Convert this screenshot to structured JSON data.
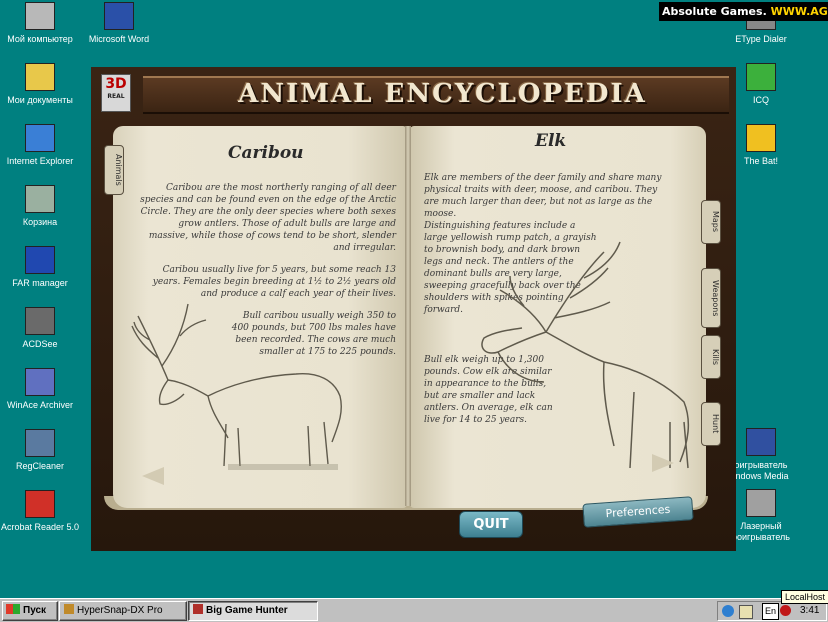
{
  "banner": {
    "prefix": "Absolute Games.",
    "site": "WWW.AG.RU"
  },
  "desktop_left": [
    {
      "label": "Мой компьютер",
      "icon": "my-computer-icon"
    },
    {
      "label": "Мои документы",
      "icon": "my-documents-icon"
    },
    {
      "label": "Internet Explorer",
      "icon": "internet-explorer-icon"
    },
    {
      "label": "Корзина",
      "icon": "recycle-bin-icon"
    },
    {
      "label": "FAR manager",
      "icon": "far-manager-icon"
    },
    {
      "label": "ACDSee",
      "icon": "acdsee-icon"
    },
    {
      "label": "WinAce Archiver",
      "icon": "winace-icon"
    },
    {
      "label": "RegCleaner",
      "icon": "regcleaner-icon"
    },
    {
      "label": "Acrobat Reader 5.0",
      "icon": "acrobat-reader-icon"
    }
  ],
  "desktop_mid": [
    {
      "label": "Microsoft Word",
      "icon": "word-icon"
    }
  ],
  "desktop_right": [
    {
      "label": "EType Dialer",
      "icon": "etype-dialer-icon"
    },
    {
      "label": "ICQ",
      "icon": "icq-icon"
    },
    {
      "label": "The Bat!",
      "icon": "the-bat-icon"
    },
    {
      "label": "оигрыватель\nindows Media",
      "icon": "windows-media-icon"
    },
    {
      "label": "Лазерный\nроигрыватель",
      "icon": "cd-player-icon"
    }
  ],
  "game": {
    "title": "ANIMAL ENCYCLOPEDIA",
    "logo_top": "3D",
    "logo_bottom": "REAL",
    "left_tab": "Animals",
    "right_tabs": [
      "Maps",
      "Weapons",
      "Kills",
      "Hunt"
    ],
    "left_page": {
      "title": "Caribou",
      "paragraphs": [
        "Caribou are the most northerly ranging of all deer species and can be found even on the edge of the Arctic Circle. They are the only deer species where both sexes grow antlers. Those of adult bulls are large and massive, while those of cows tend to be short, slender and irregular.",
        "Caribou usually live for 5 years, but some reach 13 years. Females begin breeding at 1½ to 2½ years old and produce a calf each year of their lives.",
        "Bull caribou usually weigh 350 to 400 pounds, but 700 lbs males have been recorded. The cows are much smaller at 175 to 225 pounds."
      ]
    },
    "right_page": {
      "title": "Elk",
      "paragraphs": [
        "Elk are members of the deer family and share many physical traits with deer, moose, and caribou. They are much larger than deer, but not as large as the moose.",
        "Distinguishing features include a large yellowish rump patch, a grayish to brownish body, and dark brown legs and neck. The antlers of the dominant bulls are very large, sweeping gracefully back over the shoulders with spikes pointing forward.",
        "Bull elk weigh up to 1,300 pounds. Cow elk are similar in appearance to the bulls, but are smaller and lack antlers. On average, elk can live for 14 to 25 years."
      ]
    },
    "quit_label": "QUIT",
    "preferences_label": "Preferences"
  },
  "taskbar": {
    "start_label": "Пуск",
    "tasks": [
      "HyperSnap-DX Pro",
      "Big Game Hunter"
    ],
    "active_task": "Big Game Hunter",
    "lang": "En",
    "time": "3:41",
    "tooltip": "LocalHost"
  }
}
